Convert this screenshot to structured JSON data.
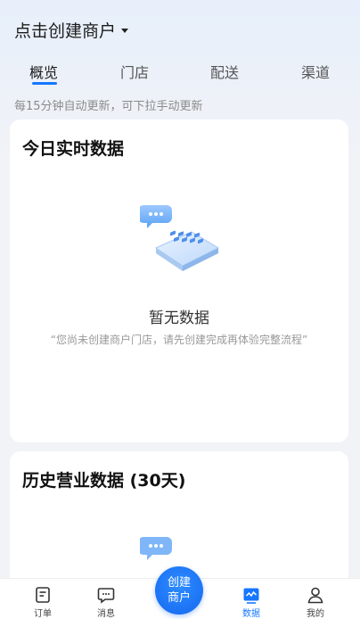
{
  "header": {
    "title": "点击创建商户"
  },
  "tabs": [
    {
      "label": "概览",
      "active": true
    },
    {
      "label": "门店",
      "active": false
    },
    {
      "label": "配送",
      "active": false
    },
    {
      "label": "渠道",
      "active": false
    }
  ],
  "hint": "每15分钟自动更新，可下拉手动更新",
  "realtime_card": {
    "title": "今日实时数据",
    "empty_title": "暂无数据",
    "empty_desc": "“您尚未创建商户门店，请先创建完成再体验完整流程”"
  },
  "history_card": {
    "title": "历史营业数据 (30天)"
  },
  "bottom_nav": {
    "items": [
      {
        "label": "订单",
        "icon": "order-icon"
      },
      {
        "label": "消息",
        "icon": "message-icon"
      },
      {
        "label": "数据",
        "icon": "data-chart-icon",
        "active": true
      },
      {
        "label": "我的",
        "icon": "user-icon"
      }
    ],
    "fab": {
      "line1": "创建",
      "line2": "商户"
    }
  },
  "colors": {
    "accent": "#1677ff",
    "background": "#f2f3f6"
  }
}
